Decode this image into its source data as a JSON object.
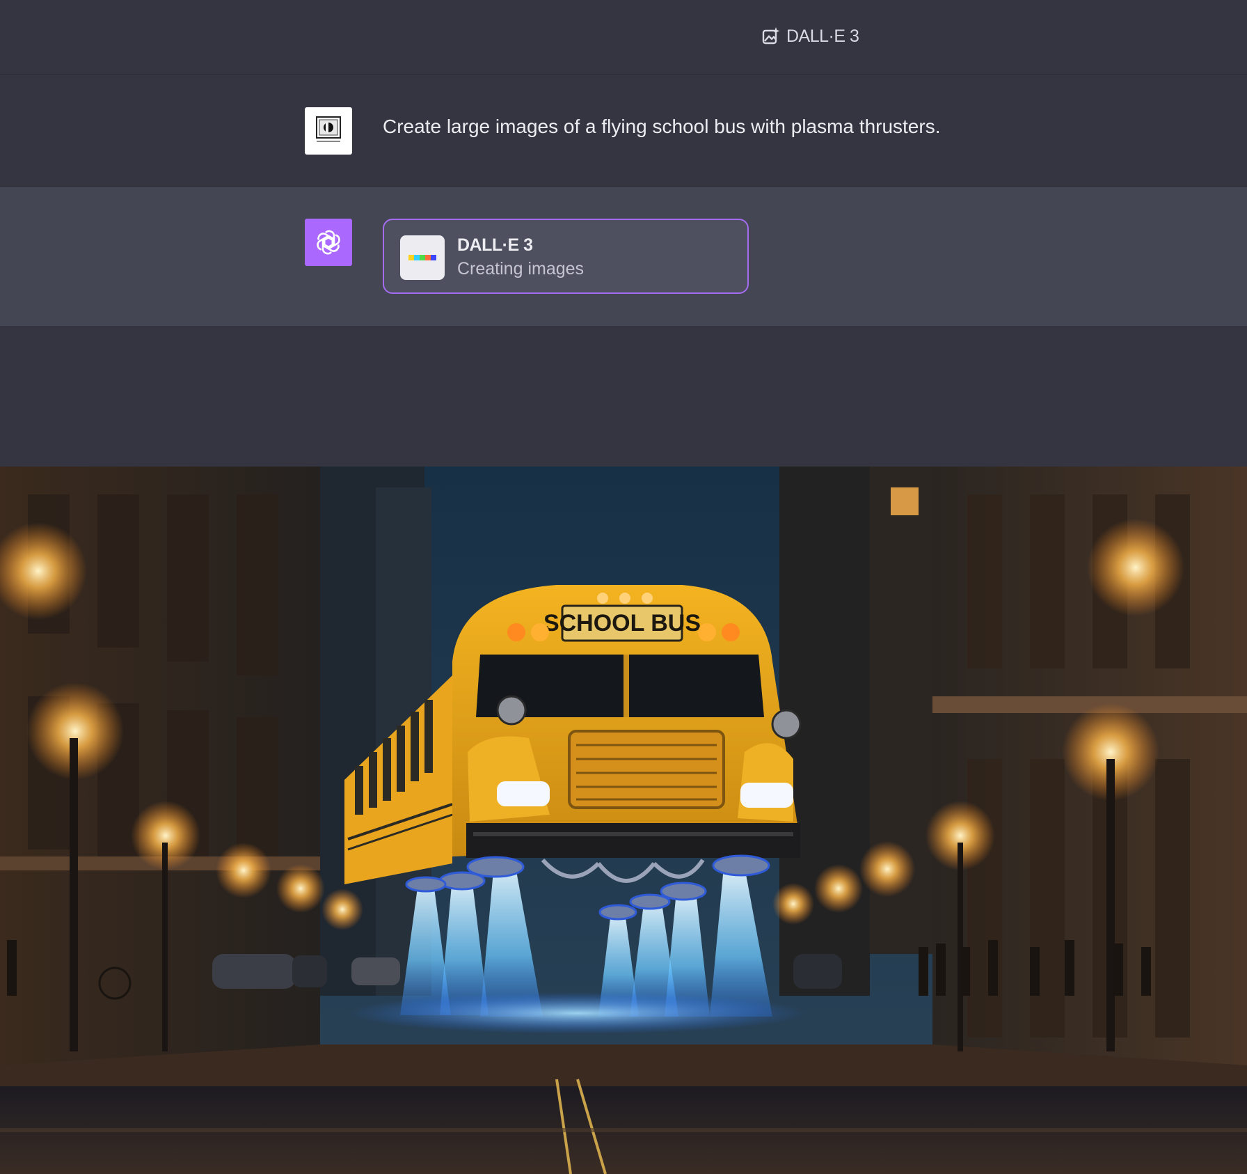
{
  "header": {
    "model_name": "DALL·E 3",
    "model_icon": "image-sparkle-icon"
  },
  "conversation": {
    "user_message": {
      "avatar": "user-avatar",
      "text": "Create large images of a flying school bus with plasma thrusters."
    },
    "assistant_message": {
      "avatar": "openai-logo-icon",
      "tool_call": {
        "name": "DALL·E 3",
        "status": "Creating images"
      }
    }
  },
  "generated_image": {
    "description_label": "",
    "bus_sign_text": "SCHOOL BUS"
  },
  "colors": {
    "background": "#343541",
    "assistant_background": "#444654",
    "accent": "#ab68ff",
    "card_border": "#a46cf0",
    "text": "#ececf1"
  }
}
